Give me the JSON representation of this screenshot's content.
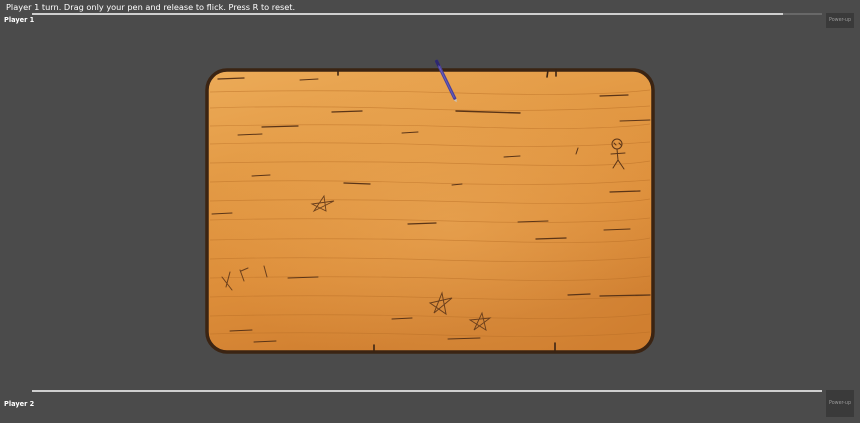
{
  "status": {
    "message": "Player 1 turn. Drag only your pen and release to flick. Press R to reset."
  },
  "players": [
    {
      "label": "Player 1",
      "powerup_label": "Power-up",
      "progress": 0.95
    },
    {
      "label": "Player 2",
      "powerup_label": "Power-up",
      "progress": 1.0
    }
  ],
  "colors": {
    "background": "#4b4b4b",
    "board_wood": "#e0953f",
    "board_border": "#3b2413",
    "pen_body": "#4a3f9a",
    "text": "#ffffff",
    "powerup_text": "#9a9a9a"
  },
  "board": {
    "pen_icon": "pen-icon",
    "carvings": [
      "stickman-carving",
      "star-carving",
      "star-carving",
      "star-carving",
      "tally-marks"
    ]
  }
}
